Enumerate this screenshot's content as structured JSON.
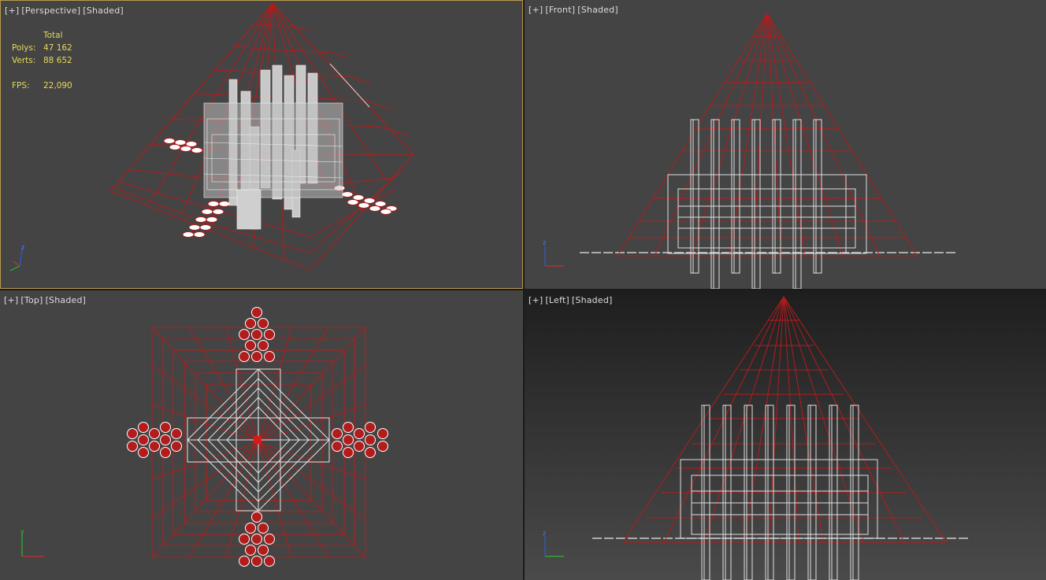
{
  "viewports": {
    "perspective": {
      "menu": "[+]",
      "view": "[Perspective]",
      "shading": "[Shaded]",
      "stats": {
        "header": "Total",
        "polys_label": "Polys:",
        "polys_value": "47 162",
        "verts_label": "Verts:",
        "verts_value": "88 652",
        "fps_label": "FPS:",
        "fps_value": "22,090"
      }
    },
    "front": {
      "menu": "[+]",
      "view": "[Front]",
      "shading": "[Shaded]"
    },
    "top": {
      "menu": "[+]",
      "view": "[Top]",
      "shading": "[Shaded]"
    },
    "left": {
      "menu": "[+]",
      "view": "[Left]",
      "shading": "[Shaded]"
    }
  },
  "colors": {
    "wire_red": "#b31c1c",
    "wire_white": "#d9d9d9",
    "active_border": "#b89b4e",
    "stats_text": "#e8d85a"
  }
}
